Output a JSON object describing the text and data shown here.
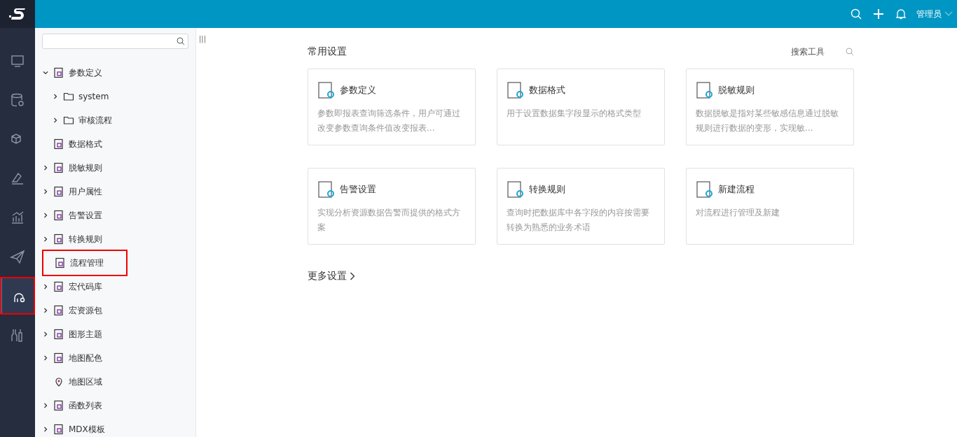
{
  "header": {
    "user": "管理员"
  },
  "rail": [
    {
      "selected": false,
      "highlighted": false
    },
    {
      "selected": false,
      "highlighted": false
    },
    {
      "selected": false,
      "highlighted": false
    },
    {
      "selected": false,
      "highlighted": false
    },
    {
      "selected": false,
      "highlighted": false
    },
    {
      "selected": false,
      "highlighted": false
    },
    {
      "selected": true,
      "highlighted": true
    },
    {
      "selected": false,
      "highlighted": false
    }
  ],
  "tree": {
    "handle": "|||",
    "items": [
      {
        "label": "参数定义",
        "kind": "item",
        "expandable": true,
        "expanded": true,
        "highlighted": false,
        "children": [
          {
            "label": "system",
            "kind": "folder",
            "expandable": true,
            "expanded": false,
            "highlighted": false
          },
          {
            "label": "审核流程",
            "kind": "folder",
            "expandable": true,
            "expanded": false,
            "highlighted": false
          }
        ]
      },
      {
        "label": "数据格式",
        "kind": "item",
        "expandable": false,
        "highlighted": false
      },
      {
        "label": "脱敏规则",
        "kind": "item",
        "expandable": true,
        "expanded": false,
        "highlighted": false
      },
      {
        "label": "用户属性",
        "kind": "item",
        "expandable": true,
        "expanded": false,
        "highlighted": false
      },
      {
        "label": "告警设置",
        "kind": "item",
        "expandable": true,
        "expanded": false,
        "highlighted": false
      },
      {
        "label": "转换规则",
        "kind": "item",
        "expandable": true,
        "expanded": false,
        "highlighted": false
      },
      {
        "label": "流程管理",
        "kind": "item",
        "expandable": false,
        "highlighted": true
      },
      {
        "label": "宏代码库",
        "kind": "item",
        "expandable": true,
        "expanded": false,
        "highlighted": false
      },
      {
        "label": "宏资源包",
        "kind": "item",
        "expandable": true,
        "expanded": false,
        "highlighted": false
      },
      {
        "label": "图形主题",
        "kind": "item",
        "expandable": true,
        "expanded": false,
        "highlighted": false
      },
      {
        "label": "地图配色",
        "kind": "item",
        "expandable": true,
        "expanded": false,
        "highlighted": false
      },
      {
        "label": "地图区域",
        "kind": "pin",
        "expandable": false,
        "highlighted": false
      },
      {
        "label": "函数列表",
        "kind": "item",
        "expandable": true,
        "expanded": false,
        "highlighted": false
      },
      {
        "label": "MDX模板",
        "kind": "item",
        "expandable": true,
        "expanded": false,
        "highlighted": false
      }
    ]
  },
  "main": {
    "title": "常用设置",
    "search_label": "搜索工具",
    "cards": [
      {
        "title": "参数定义",
        "description": "参数即报表查询筛选条件，用户可通过改变参数查询条件值改变报表..."
      },
      {
        "title": "数据格式",
        "description": "用于设置数据集字段显示的格式类型"
      },
      {
        "title": "脱敏规则",
        "description": "数据脱敏是指对某些敏感信息通过脱敏规则进行数据的变形，实现敏..."
      },
      {
        "title": "告警设置",
        "description": "实现分析资源数据告警而提供的格式方案"
      },
      {
        "title": "转换规则",
        "description": "查询时把数据库中各字段的内容按需要转换为熟悉的业务术语"
      },
      {
        "title": "新建流程",
        "description": "对流程进行管理及新建"
      }
    ],
    "more": "更多设置"
  }
}
